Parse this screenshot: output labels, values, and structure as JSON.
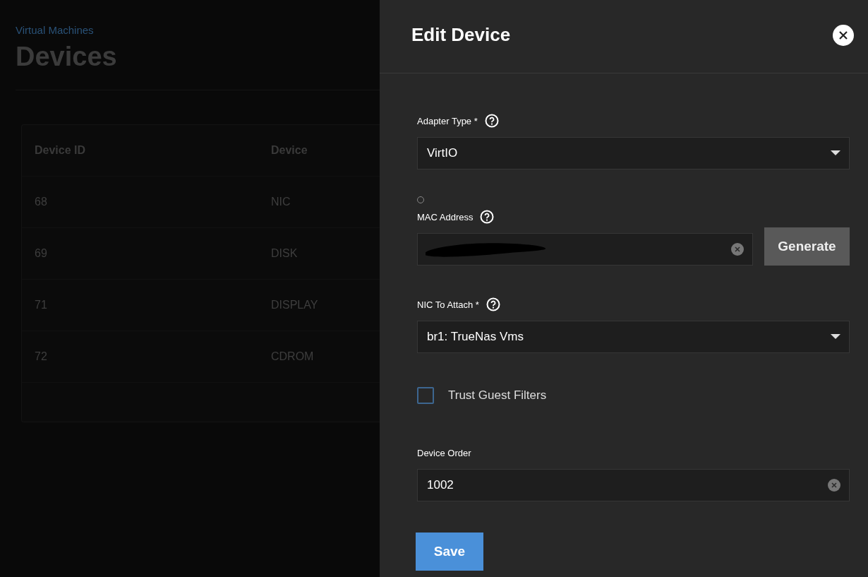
{
  "background_page": {
    "breadcrumb": "Virtual Machines",
    "title": "Devices",
    "table": {
      "columns": [
        "Device ID",
        "Device"
      ],
      "rows": [
        [
          "68",
          "NIC"
        ],
        [
          "69",
          "DISK"
        ],
        [
          "71",
          "DISPLAY"
        ],
        [
          "72",
          "CDROM"
        ]
      ]
    }
  },
  "panel": {
    "title": "Edit Device",
    "fields": [
      {
        "kind": "select",
        "label": "Adapter Type *",
        "help": true,
        "value": "VirtIO"
      },
      {
        "kind": "text",
        "label": "MAC Address",
        "help": true,
        "indicator": true,
        "redacted": true,
        "clearable": true,
        "button": "Generate"
      },
      {
        "kind": "select",
        "label": "NIC To Attach *",
        "help": true,
        "value": "br1: TrueNas Vms"
      },
      {
        "kind": "checkbox",
        "label": "Trust Guest Filters",
        "checked": false
      },
      {
        "kind": "text",
        "label": "Device Order",
        "value": "1002",
        "clearable": true
      }
    ],
    "save_button": "Save"
  }
}
